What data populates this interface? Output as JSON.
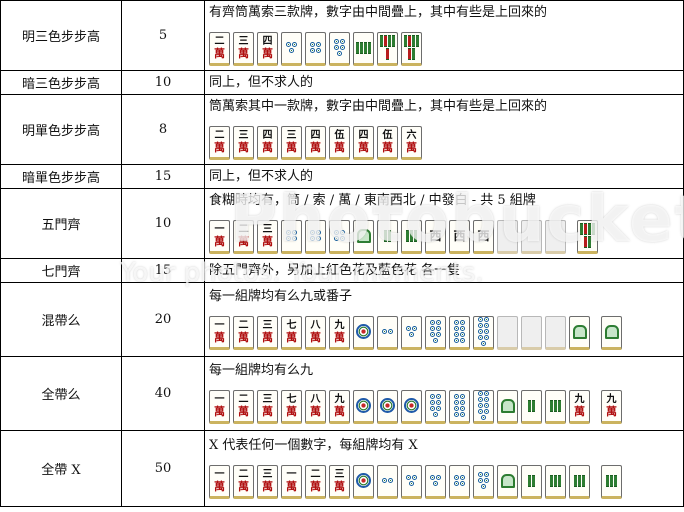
{
  "rows": [
    {
      "name": "明三色步步高",
      "points": "5",
      "desc": "有齊筒萬索三款牌，數字由中間疊上，其中有些是上回來的",
      "tiles": [
        {
          "k": "wan",
          "n": "二"
        },
        {
          "k": "wan",
          "n": "三"
        },
        {
          "k": "wan",
          "n": "四"
        },
        {
          "k": "dot",
          "n": 3
        },
        {
          "k": "dot",
          "n": 4
        },
        {
          "k": "dot",
          "n": 5
        },
        {
          "k": "bam",
          "n": 4
        },
        {
          "k": "bam",
          "n": 5
        },
        {
          "k": "bam",
          "n": 6
        }
      ]
    },
    {
      "name": "暗三色步步高",
      "points": "10",
      "desc": "同上，但不求人的",
      "tiles": []
    },
    {
      "name": "明單色步步高",
      "points": "8",
      "desc": "筒萬索其中一款牌，數字由中間疊上，其中有些是上回來的",
      "tiles": [
        {
          "k": "wan",
          "n": "二"
        },
        {
          "k": "wan",
          "n": "三"
        },
        {
          "k": "wan",
          "n": "四"
        },
        {
          "k": "wan",
          "n": "三"
        },
        {
          "k": "wan",
          "n": "四"
        },
        {
          "k": "wan",
          "n": "伍"
        },
        {
          "k": "wan",
          "n": "四"
        },
        {
          "k": "wan",
          "n": "伍"
        },
        {
          "k": "wan",
          "n": "六"
        }
      ]
    },
    {
      "name": "暗單色步步高",
      "points": "15",
      "desc": "同上，但不求人的",
      "tiles": []
    },
    {
      "name": "五門齊",
      "points": "10",
      "desc": "食糊時均有，筒 / 索 / 萬 / 東南西北 / 中發白 - 共 5 組牌",
      "tiles": [
        {
          "k": "wan",
          "n": "一"
        },
        {
          "k": "wan",
          "n": "二"
        },
        {
          "k": "wan",
          "n": "三"
        },
        {
          "k": "dot",
          "n": 4
        },
        {
          "k": "dot",
          "n": 4
        },
        {
          "k": "dot",
          "n": 4
        },
        {
          "k": "bird"
        },
        {
          "k": "bam",
          "n": 2
        },
        {
          "k": "bam",
          "n": 3
        },
        {
          "k": "honor",
          "t": "西"
        },
        {
          "k": "honor",
          "t": "西"
        },
        {
          "k": "honor",
          "t": "西"
        },
        {
          "k": "blank"
        },
        {
          "k": "blank"
        },
        {
          "k": "blank"
        },
        {
          "k": "bam",
          "n": 6,
          "gap": true
        }
      ]
    },
    {
      "name": "七門齊",
      "points": "15",
      "desc": "除五門齊外，另加上紅色花及藍色花 各一隻",
      "tiles": []
    },
    {
      "name": "混帶么",
      "points": "20",
      "desc": "每一組牌均有么九或番子",
      "tiles": [
        {
          "k": "wan",
          "n": "一"
        },
        {
          "k": "wan",
          "n": "二"
        },
        {
          "k": "wan",
          "n": "三"
        },
        {
          "k": "wan",
          "n": "七"
        },
        {
          "k": "wan",
          "n": "八"
        },
        {
          "k": "wan",
          "n": "九"
        },
        {
          "k": "dot",
          "n": 1
        },
        {
          "k": "dot",
          "n": 2
        },
        {
          "k": "dot",
          "n": 3
        },
        {
          "k": "dot",
          "n": 7
        },
        {
          "k": "dot",
          "n": 8
        },
        {
          "k": "dot",
          "n": 9
        },
        {
          "k": "blank"
        },
        {
          "k": "blank"
        },
        {
          "k": "blank"
        },
        {
          "k": "bird"
        },
        {
          "k": "bird",
          "gap": true
        }
      ]
    },
    {
      "name": "全帶么",
      "points": "40",
      "desc": "每一組牌均有么九",
      "tiles": [
        {
          "k": "wan",
          "n": "一"
        },
        {
          "k": "wan",
          "n": "二"
        },
        {
          "k": "wan",
          "n": "三"
        },
        {
          "k": "wan",
          "n": "七"
        },
        {
          "k": "wan",
          "n": "八"
        },
        {
          "k": "wan",
          "n": "九"
        },
        {
          "k": "dot",
          "n": 1
        },
        {
          "k": "dot",
          "n": 1
        },
        {
          "k": "dot",
          "n": 1
        },
        {
          "k": "dot",
          "n": 7
        },
        {
          "k": "dot",
          "n": 8
        },
        {
          "k": "dot",
          "n": 9
        },
        {
          "k": "bird"
        },
        {
          "k": "bam",
          "n": 2
        },
        {
          "k": "bam",
          "n": 3
        },
        {
          "k": "wan",
          "n": "九"
        },
        {
          "k": "wan",
          "n": "九",
          "gap": true
        }
      ]
    },
    {
      "name": "全帶 X",
      "points": "50",
      "desc": "X 代表任何一個數字，每組牌均有 X",
      "tiles": [
        {
          "k": "wan",
          "n": "一"
        },
        {
          "k": "wan",
          "n": "二"
        },
        {
          "k": "wan",
          "n": "三"
        },
        {
          "k": "wan",
          "n": "一"
        },
        {
          "k": "wan",
          "n": "二"
        },
        {
          "k": "wan",
          "n": "三"
        },
        {
          "k": "dot",
          "n": 1
        },
        {
          "k": "dot",
          "n": 2
        },
        {
          "k": "dot",
          "n": 3
        },
        {
          "k": "dot",
          "n": 3
        },
        {
          "k": "dot",
          "n": 4
        },
        {
          "k": "dot",
          "n": 5
        },
        {
          "k": "bird"
        },
        {
          "k": "bam",
          "n": 2
        },
        {
          "k": "bam",
          "n": 3
        },
        {
          "k": "bam",
          "n": 3
        },
        {
          "k": "bam",
          "n": 3,
          "gap": true
        }
      ]
    }
  ],
  "watermark": {
    "logo": "Photobucket",
    "tagline": "Your photos. Your moments."
  },
  "colors": {
    "border": "#000000",
    "wan_red": "#b01010",
    "bamboo_green": "#2e7d32",
    "dot_blue": "#155e9c",
    "tile_back": "#cbb35f"
  }
}
